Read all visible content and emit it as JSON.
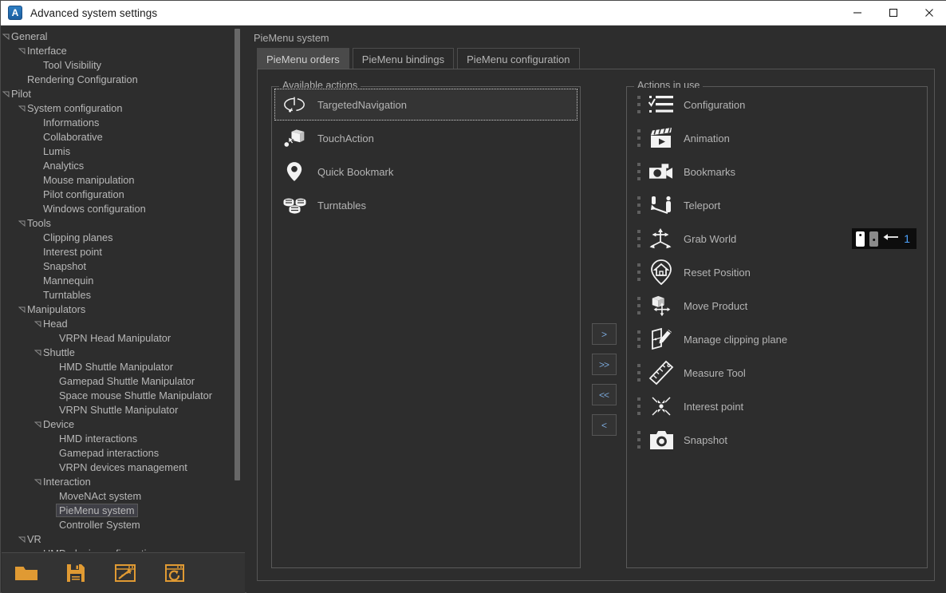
{
  "window": {
    "title": "Advanced system settings",
    "app_icon": "app-logo-a-icon",
    "app_icon_letter": "A",
    "controls": {
      "minimize": "minimize-icon",
      "maximize": "maximize-icon",
      "close": "close-icon"
    }
  },
  "sidebar": {
    "tree": [
      {
        "label": "General",
        "depth": 0,
        "expander": "expanded",
        "selected": false
      },
      {
        "label": "Interface",
        "depth": 1,
        "expander": "expanded",
        "selected": false
      },
      {
        "label": "Tool Visibility",
        "depth": 2,
        "expander": "none",
        "selected": false
      },
      {
        "label": "Rendering Configuration",
        "depth": 1,
        "expander": "none",
        "selected": false
      },
      {
        "label": "Pilot",
        "depth": 0,
        "expander": "expanded",
        "selected": false
      },
      {
        "label": "System configuration",
        "depth": 1,
        "expander": "expanded",
        "selected": false
      },
      {
        "label": "Informations",
        "depth": 2,
        "expander": "none",
        "selected": false
      },
      {
        "label": "Collaborative",
        "depth": 2,
        "expander": "none",
        "selected": false
      },
      {
        "label": "Lumis",
        "depth": 2,
        "expander": "none",
        "selected": false
      },
      {
        "label": "Analytics",
        "depth": 2,
        "expander": "none",
        "selected": false
      },
      {
        "label": "Mouse manipulation",
        "depth": 2,
        "expander": "none",
        "selected": false
      },
      {
        "label": "Pilot configuration",
        "depth": 2,
        "expander": "none",
        "selected": false
      },
      {
        "label": "Windows configuration",
        "depth": 2,
        "expander": "none",
        "selected": false
      },
      {
        "label": "Tools",
        "depth": 1,
        "expander": "expanded",
        "selected": false
      },
      {
        "label": "Clipping planes",
        "depth": 2,
        "expander": "none",
        "selected": false
      },
      {
        "label": "Interest point",
        "depth": 2,
        "expander": "none",
        "selected": false
      },
      {
        "label": "Snapshot",
        "depth": 2,
        "expander": "none",
        "selected": false
      },
      {
        "label": "Mannequin",
        "depth": 2,
        "expander": "none",
        "selected": false
      },
      {
        "label": "Turntables",
        "depth": 2,
        "expander": "none",
        "selected": false
      },
      {
        "label": "Manipulators",
        "depth": 1,
        "expander": "expanded",
        "selected": false
      },
      {
        "label": "Head",
        "depth": 2,
        "expander": "expanded",
        "selected": false
      },
      {
        "label": "VRPN Head Manipulator",
        "depth": 3,
        "expander": "none",
        "selected": false
      },
      {
        "label": "Shuttle",
        "depth": 2,
        "expander": "expanded",
        "selected": false
      },
      {
        "label": "HMD Shuttle Manipulator",
        "depth": 3,
        "expander": "none",
        "selected": false
      },
      {
        "label": "Gamepad Shuttle Manipulator",
        "depth": 3,
        "expander": "none",
        "selected": false
      },
      {
        "label": "Space mouse Shuttle Manipulator",
        "depth": 3,
        "expander": "none",
        "selected": false
      },
      {
        "label": "VRPN Shuttle Manipulator",
        "depth": 3,
        "expander": "none",
        "selected": false
      },
      {
        "label": "Device",
        "depth": 2,
        "expander": "expanded",
        "selected": false
      },
      {
        "label": "HMD interactions",
        "depth": 3,
        "expander": "none",
        "selected": false
      },
      {
        "label": "Gamepad interactions",
        "depth": 3,
        "expander": "none",
        "selected": false
      },
      {
        "label": "VRPN devices management",
        "depth": 3,
        "expander": "none",
        "selected": false
      },
      {
        "label": "Interaction",
        "depth": 2,
        "expander": "expanded",
        "selected": false
      },
      {
        "label": "MoveNAct system",
        "depth": 3,
        "expander": "none",
        "selected": false
      },
      {
        "label": "PieMenu system",
        "depth": 3,
        "expander": "none",
        "selected": true
      },
      {
        "label": "Controller System",
        "depth": 3,
        "expander": "none",
        "selected": false
      },
      {
        "label": "VR",
        "depth": 1,
        "expander": "expanded",
        "selected": false
      },
      {
        "label": "HMD plugin configuration",
        "depth": 2,
        "expander": "none",
        "selected": false
      }
    ]
  },
  "bottom_toolbar": {
    "buttons": [
      {
        "name": "open-button",
        "icon": "folder-open-icon"
      },
      {
        "name": "save-button",
        "icon": "floppy-save-icon"
      },
      {
        "name": "apply-button",
        "icon": "magic-wand-window-icon"
      },
      {
        "name": "reset-button",
        "icon": "reset-window-icon"
      }
    ],
    "accent_color": "#e09a33"
  },
  "main": {
    "panel_title": "PieMenu system",
    "tabs": [
      {
        "label": "PieMenu orders",
        "active": true
      },
      {
        "label": "PieMenu bindings",
        "active": false
      },
      {
        "label": "PieMenu configuration",
        "active": false
      }
    ],
    "available_group": {
      "title": "Available actions",
      "items": [
        {
          "label": "TargetedNavigation",
          "icon": "targeted-navigation-icon",
          "focused": true
        },
        {
          "label": "TouchAction",
          "icon": "touch-action-icon",
          "focused": false
        },
        {
          "label": "Quick Bookmark",
          "icon": "map-pin-icon",
          "focused": false
        },
        {
          "label": "Turntables",
          "icon": "turntables-icon",
          "focused": false
        }
      ]
    },
    "inuse_group": {
      "title": "Actions in use",
      "items": [
        {
          "label": "Configuration",
          "icon": "checklist-icon"
        },
        {
          "label": "Animation",
          "icon": "clapperboard-icon"
        },
        {
          "label": "Bookmarks",
          "icon": "video-camera-icon"
        },
        {
          "label": "Teleport",
          "icon": "teleport-icon"
        },
        {
          "label": "Grab World",
          "icon": "grab-world-axis-icon",
          "binding": {
            "controller_left": "active",
            "controller_right": "inactive",
            "arrow": "arrow-left-icon",
            "value": "1"
          }
        },
        {
          "label": "Reset Position",
          "icon": "home-pin-icon"
        },
        {
          "label": "Move Product",
          "icon": "move-product-icon"
        },
        {
          "label": "Manage clipping plane",
          "icon": "clipping-plane-icon"
        },
        {
          "label": "Measure Tool",
          "icon": "ruler-icon"
        },
        {
          "label": "Interest point",
          "icon": "interest-point-icon"
        },
        {
          "label": "Snapshot",
          "icon": "camera-icon"
        }
      ]
    },
    "transfer_buttons": [
      {
        "label": ">",
        "name": "move-right-button"
      },
      {
        "label": ">>",
        "name": "move-all-right-button"
      },
      {
        "label": "<<",
        "name": "move-all-left-button"
      },
      {
        "label": "<",
        "name": "move-left-button"
      }
    ]
  }
}
